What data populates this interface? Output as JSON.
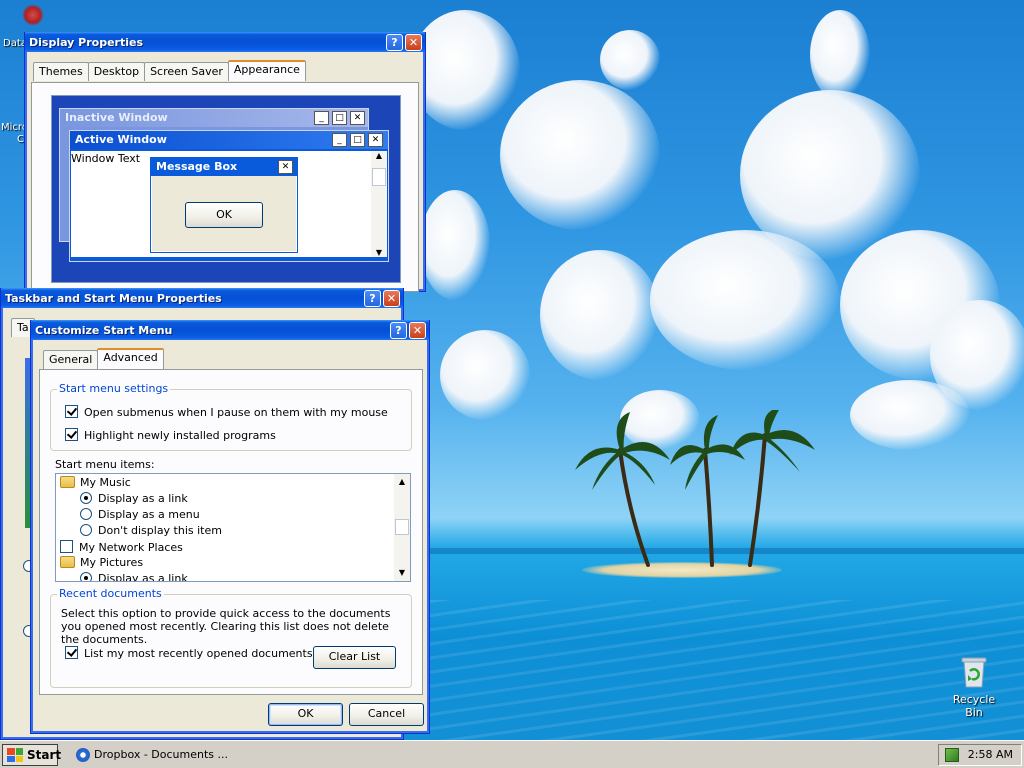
{
  "colors": {
    "xp_blue": "#0550d4",
    "face": "#ece9d8",
    "accent_tab": "#e68b2c",
    "group_legend": "#0046d5"
  },
  "desktop": {
    "left_labels": [
      "Data",
      "Micro",
      "C"
    ],
    "recycle_bin_label": "Recycle Bin"
  },
  "display_properties": {
    "title": "Display Properties",
    "help": "?",
    "close": "✕",
    "tabs": [
      "Themes",
      "Desktop",
      "Screen Saver",
      "Appearance"
    ],
    "active_tab": "Appearance",
    "preview": {
      "inactive_title": "Inactive Window",
      "active_title": "Active Window",
      "window_text": "Window Text",
      "message_box_title": "Message Box",
      "ok": "OK",
      "min": "_",
      "max": "□",
      "close": "✕"
    }
  },
  "taskbar_props": {
    "title": "Taskbar and Start Menu Properties",
    "help": "?",
    "close": "✕",
    "tab_stub": "Ta"
  },
  "customize": {
    "title": "Customize Start Menu",
    "help": "?",
    "close": "✕",
    "tabs": [
      "General",
      "Advanced"
    ],
    "active_tab": "Advanced",
    "start_menu_settings": {
      "legend": "Start menu settings",
      "open_submenus": "Open submenus when I pause on them with my mouse",
      "highlight_new": "Highlight newly installed programs"
    },
    "items_label": "Start menu items:",
    "items": [
      {
        "kind": "folder",
        "label": "My Music"
      },
      {
        "kind": "radio",
        "checked": true,
        "label": "Display as a link"
      },
      {
        "kind": "radio",
        "checked": false,
        "label": "Display as a menu"
      },
      {
        "kind": "radio",
        "checked": false,
        "label": "Don't display this item"
      },
      {
        "kind": "check",
        "checked": false,
        "label": "My Network Places"
      },
      {
        "kind": "folder",
        "label": "My Pictures"
      },
      {
        "kind": "radio",
        "checked": true,
        "label": "Display as a link"
      }
    ],
    "recent": {
      "legend": "Recent documents",
      "description": "Select this option to provide quick access to the documents you opened most recently.  Clearing this list does not delete the documents.",
      "list_recent": "List my most recently opened documents",
      "clear_list": "Clear List"
    },
    "ok": "OK",
    "cancel": "Cancel"
  },
  "taskbar": {
    "start": "Start",
    "task_item": "Dropbox - Documents ...",
    "clock": "2:58 AM"
  }
}
